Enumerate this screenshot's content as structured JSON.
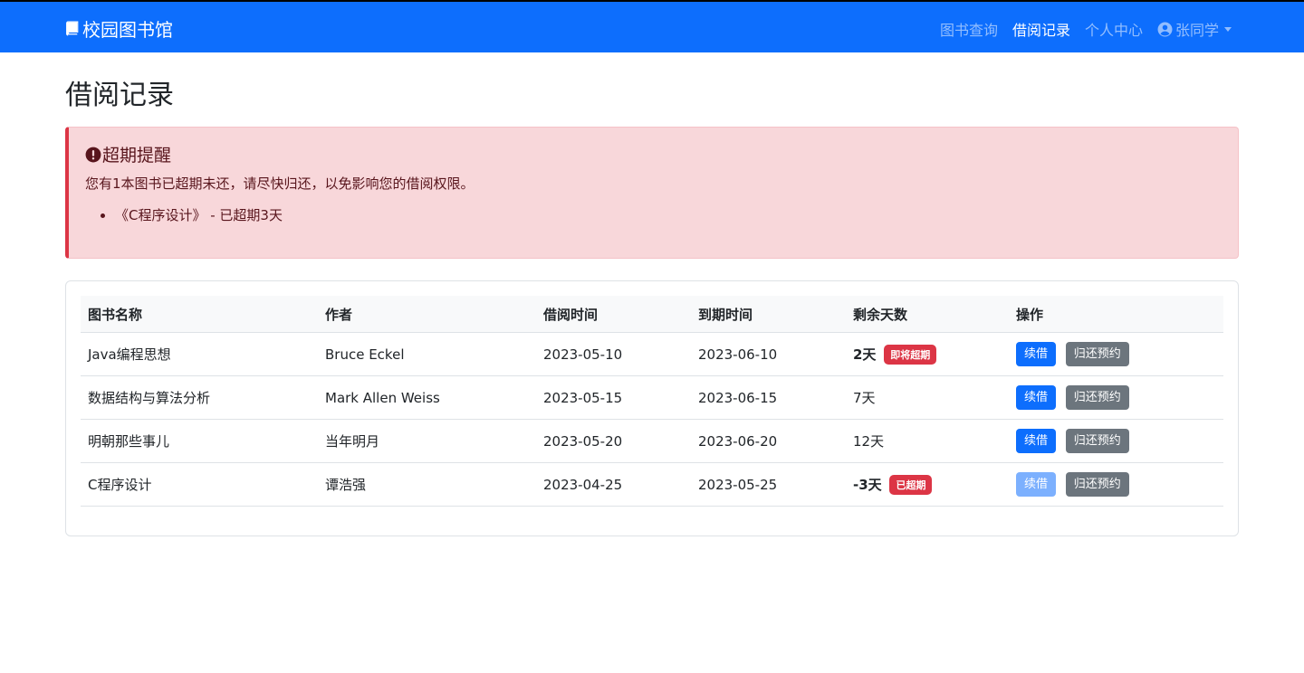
{
  "navbar": {
    "brand": "校园图书馆",
    "links": [
      {
        "label": "图书查询",
        "active": false
      },
      {
        "label": "借阅记录",
        "active": true
      },
      {
        "label": "个人中心",
        "active": false
      }
    ],
    "user": "张同学"
  },
  "page": {
    "title": "借阅记录"
  },
  "alert": {
    "heading": "超期提醒",
    "text": "您有1本图书已超期未还，请尽快归还，以免影响您的借阅权限。",
    "items": [
      "《C程序设计》 - 已超期3天"
    ]
  },
  "table": {
    "headers": [
      "图书名称",
      "作者",
      "借阅时间",
      "到期时间",
      "剩余天数",
      "操作"
    ],
    "rows": [
      {
        "title": "Java编程思想",
        "author": "Bruce Eckel",
        "borrow": "2023-05-10",
        "due": "2023-06-10",
        "remaining": "2天",
        "badge": "即将超期",
        "renew": "续借",
        "return": "归还预约"
      },
      {
        "title": "数据结构与算法分析",
        "author": "Mark Allen Weiss",
        "borrow": "2023-05-15",
        "due": "2023-06-15",
        "remaining": "7天",
        "badge": "",
        "renew": "续借",
        "return": "归还预约"
      },
      {
        "title": "明朝那些事儿",
        "author": "当年明月",
        "borrow": "2023-05-20",
        "due": "2023-06-20",
        "remaining": "12天",
        "badge": "",
        "renew": "续借",
        "return": "归还预约"
      },
      {
        "title": "C程序设计",
        "author": "谭浩强",
        "borrow": "2023-04-25",
        "due": "2023-05-25",
        "remaining": "-3天",
        "badge": "已超期",
        "renew": "续借",
        "return": "归还预约"
      }
    ]
  },
  "colors": {
    "primary": "#0d6efd",
    "danger": "#dc3545",
    "secondary": "#6c757d",
    "alert_bg": "#f8d7da"
  },
  "icons": {
    "brand": "book-icon",
    "alert": "exclamation-circle-icon",
    "user": "user-circle-icon"
  }
}
